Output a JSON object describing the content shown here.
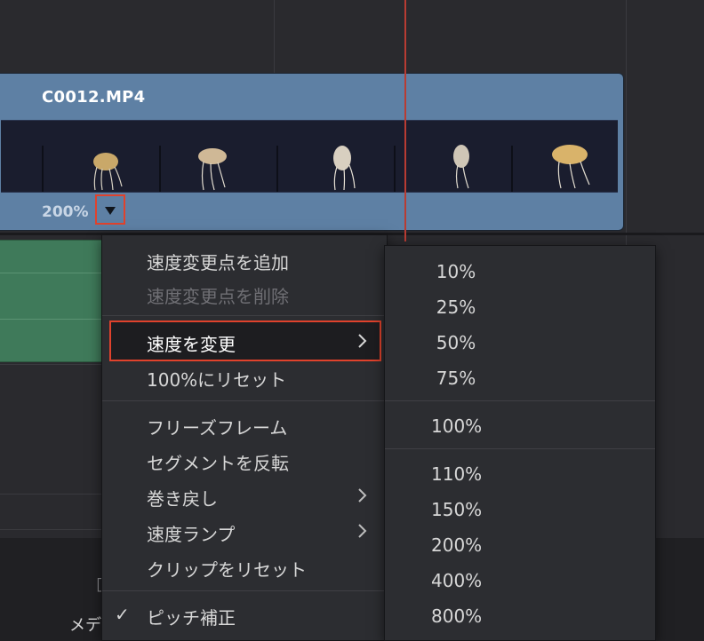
{
  "timeline": {
    "clip_name": "C0012.MP4",
    "clip_speed": "200%"
  },
  "context_menu": {
    "items": [
      {
        "label": "速度変更点を追加",
        "state": "enabled"
      },
      {
        "label": "速度変更点を削除",
        "state": "disabled"
      },
      {
        "label": "速度を変更",
        "state": "highlighted",
        "submenu": true
      },
      {
        "label": "100%にリセット",
        "state": "enabled"
      },
      {
        "label": "フリーズフレーム",
        "state": "enabled"
      },
      {
        "label": "セグメントを反転",
        "state": "enabled"
      },
      {
        "label": "巻き戻し",
        "state": "enabled",
        "submenu": true
      },
      {
        "label": "速度ランプ",
        "state": "enabled",
        "submenu": true
      },
      {
        "label": "クリップをリセット",
        "state": "enabled"
      },
      {
        "label": "ピッチ補正",
        "state": "checked"
      }
    ]
  },
  "speed_submenu": {
    "options": [
      "10%",
      "25%",
      "50%",
      "75%",
      "100%",
      "110%",
      "150%",
      "200%",
      "400%",
      "800%"
    ]
  },
  "bottom": {
    "label": "メデ"
  },
  "colors": {
    "clip": "#5e80a4",
    "audio": "#3f7a5a",
    "highlight_border": "#e0422c",
    "playhead": "#b83c33",
    "speed_arrows": "#2f8cf5"
  }
}
